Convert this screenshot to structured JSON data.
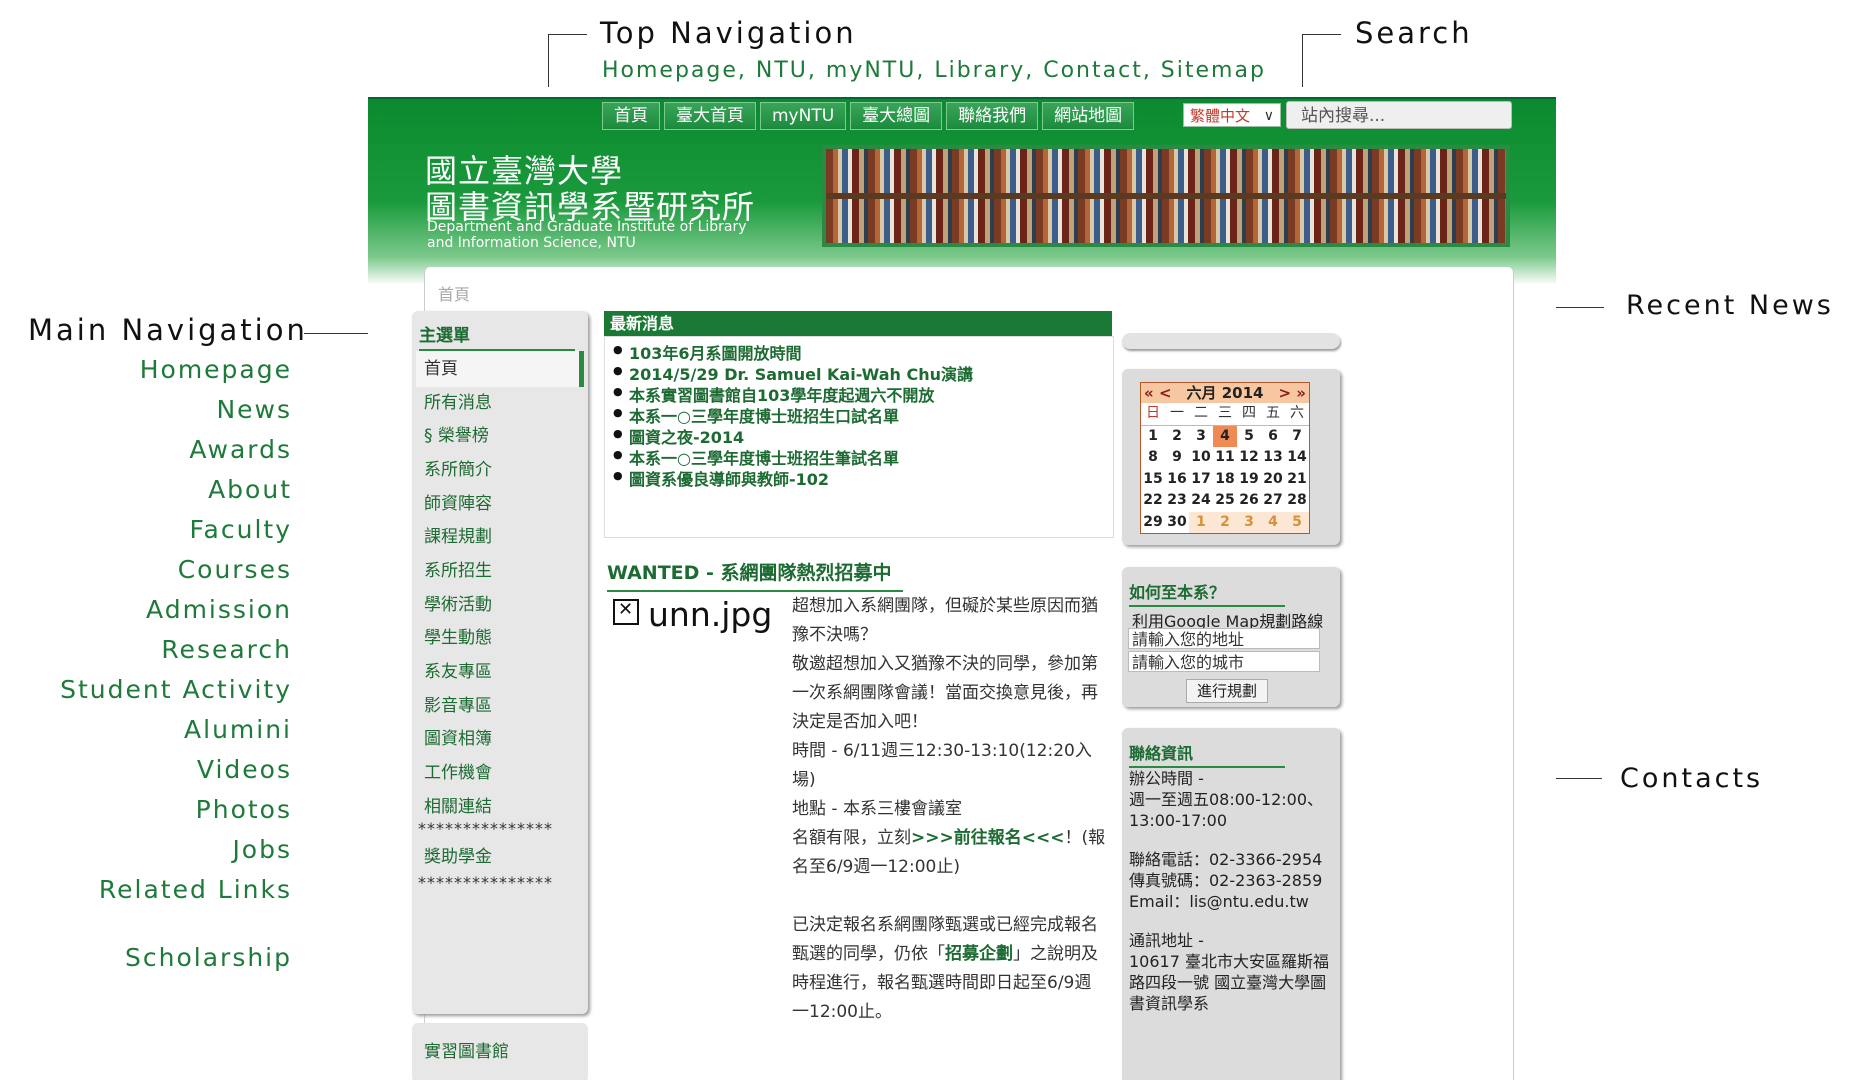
{
  "annotations": {
    "top_navigation": {
      "title": "Top Navigation",
      "subtitle": "Homepage, NTU, myNTU, Library, Contact, Sitemap"
    },
    "search": "Search",
    "main_navigation": {
      "title": "Main Navigation",
      "items": [
        "Homepage",
        "News",
        "Awards",
        "About",
        "Faculty",
        "Courses",
        "Admission",
        "Research",
        "Student Activity",
        "Alumini",
        "Videos",
        "Photos",
        "Jobs",
        "Related Links"
      ],
      "extra": "Scholarship"
    },
    "recent_news": "Recent News",
    "contacts": "Contacts"
  },
  "site": {
    "topnav": [
      "首頁",
      "臺大首頁",
      "myNTU",
      "臺大總圖",
      "聯絡我們",
      "網站地圖"
    ],
    "language": "繁體中文",
    "search_placeholder": "站內搜尋...",
    "logo_cn_1": "國立臺灣大學",
    "logo_cn_2": "圖書資訊學系暨研究所",
    "logo_en": "Department and Graduate Institute of Library and Information Science, NTU",
    "breadcrumb": "首頁",
    "menu": {
      "title": "主選單",
      "items": [
        "首頁",
        "所有消息",
        "§ 榮譽榜",
        "系所簡介",
        "師資陣容",
        "課程規劃",
        "系所招生",
        "學術活動",
        "學生動態",
        "系友專區",
        "影音專區",
        "圖資相簿",
        "工作機會",
        "相關連結"
      ],
      "stars": "***************",
      "scholarship": "獎助學金",
      "library_title": "實習圖書館"
    },
    "news": {
      "header": "最新消息",
      "items": [
        "103年6月系圖開放時間",
        "2014/5/29 Dr. Samuel Kai-Wah Chu演講",
        "本系實習圖書館自103學年度起週六不開放",
        "本系一○三學年度博士班招生口試名單",
        "圖資之夜-2014",
        "本系一○三學年度博士班招生筆試名單",
        "圖資系優良導師與教師-102"
      ]
    },
    "article": {
      "title": "WANTED - 系網團隊熱烈招募中",
      "image_name": "unn.jpg",
      "p1": "超想加入系網團隊，但礙於某些原因而猶豫不決嗎？",
      "p2": "敬邀超想加入又猶豫不決的同學，參加第一次系網團隊會議！當面交換意見後，再決定是否加入吧！",
      "p3": "時間 - 6/11週三12:30-13:10(12:20入場)",
      "p4": "地點 - 本系三樓會議室",
      "p5_a": "名額有限，立刻",
      "p5_link": ">>>前往報名<<<",
      "p5_b": "！(報名至6/9週一12:00止)",
      "p6_a": "已決定報名系網團隊甄選或已經完成報名甄選的同學，仍依「",
      "p6_link": "招募企劃",
      "p6_b": "」之說明及時程進行，報名甄選時間即日起至6/9週一12:00止。"
    },
    "calendar": {
      "prev_year": "«",
      "prev_month": "<",
      "month": "六月",
      "year": "2014",
      "next_month": ">",
      "next_year": "»",
      "weekdays": [
        "日",
        "一",
        "二",
        "三",
        "四",
        "五",
        "六"
      ],
      "weeks": [
        [
          "1",
          "2",
          "3",
          "4",
          "5",
          "6",
          "7"
        ],
        [
          "8",
          "9",
          "10",
          "11",
          "12",
          "13",
          "14"
        ],
        [
          "15",
          "16",
          "17",
          "18",
          "19",
          "20",
          "21"
        ],
        [
          "22",
          "23",
          "24",
          "25",
          "26",
          "27",
          "28"
        ],
        [
          "29",
          "30",
          "1",
          "2",
          "3",
          "4",
          "5"
        ]
      ],
      "today": "4"
    },
    "directions": {
      "title": "如何至本系？",
      "text": "利用Google Map規劃路線",
      "address_placeholder": "請輸入您的地址",
      "city_placeholder": "請輸入您的城市",
      "button": "進行規劃"
    },
    "contact": {
      "title": "聯絡資訊",
      "hours_label": "辦公時間 -",
      "hours": "週一至週五08:00-12:00、13:00-17:00",
      "phone": "聯絡電話：02-3366-2954",
      "fax": "傳真號碼：02-2363-2859",
      "email": "Email：lis@ntu.edu.tw",
      "address_label": "通訊地址 -",
      "address": "10617 臺北市大安區羅斯福路四段一號 國立臺灣大學圖書資訊學系"
    }
  },
  "colors": {
    "brand_green": "#1a7a35",
    "annotation_green": "#1e7a3a",
    "calendar_today": "#f08a55"
  }
}
